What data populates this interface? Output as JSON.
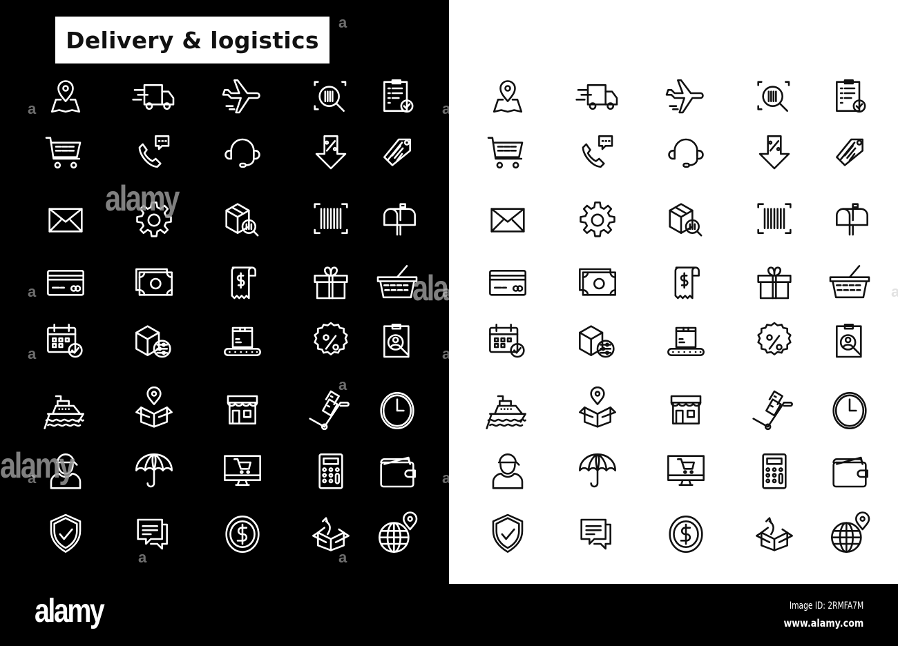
{
  "title": "Delivery & logistics",
  "colors": {
    "dark_bg": "#000000",
    "light_bg": "#ffffff",
    "dark_stroke": "#ffffff",
    "light_stroke": "#111111"
  },
  "icons": [
    "map-location-pin-icon",
    "delivery-truck-icon",
    "airplane-icon",
    "barcode-search-icon",
    "clipboard-check-icon",
    "shopping-cart-icon",
    "phone-chat-icon",
    "headset-icon",
    "discount-arrow-down-icon",
    "price-tags-icon",
    "envelope-icon",
    "gear-icon",
    "package-search-icon",
    "barcode-scan-icon",
    "mailbox-icon",
    "credit-card-icon",
    "cash-bills-icon",
    "receipt-dollar-icon",
    "gift-box-icon",
    "shopping-basket-icon",
    "calendar-check-icon",
    "package-settings-icon",
    "conveyor-box-icon",
    "discount-badge-icon",
    "clipboard-user-search-icon",
    "cargo-ship-icon",
    "box-location-pin-icon",
    "storefront-icon",
    "hand-truck-boxes-icon",
    "wall-clock-icon",
    "delivery-man-icon",
    "umbrella-icon",
    "online-shop-monitor-icon",
    "calculator-icon",
    "wallet-icon",
    "shield-check-icon",
    "chat-bubbles-icon",
    "dollar-coin-icon",
    "box-return-icon",
    "globe-location-icon"
  ],
  "watermark": {
    "brand": "alamy",
    "letter": "a"
  },
  "footer": {
    "logo": "alamy",
    "image_id": "Image ID: 2RMFA7M",
    "url": "www.alamy.com"
  }
}
